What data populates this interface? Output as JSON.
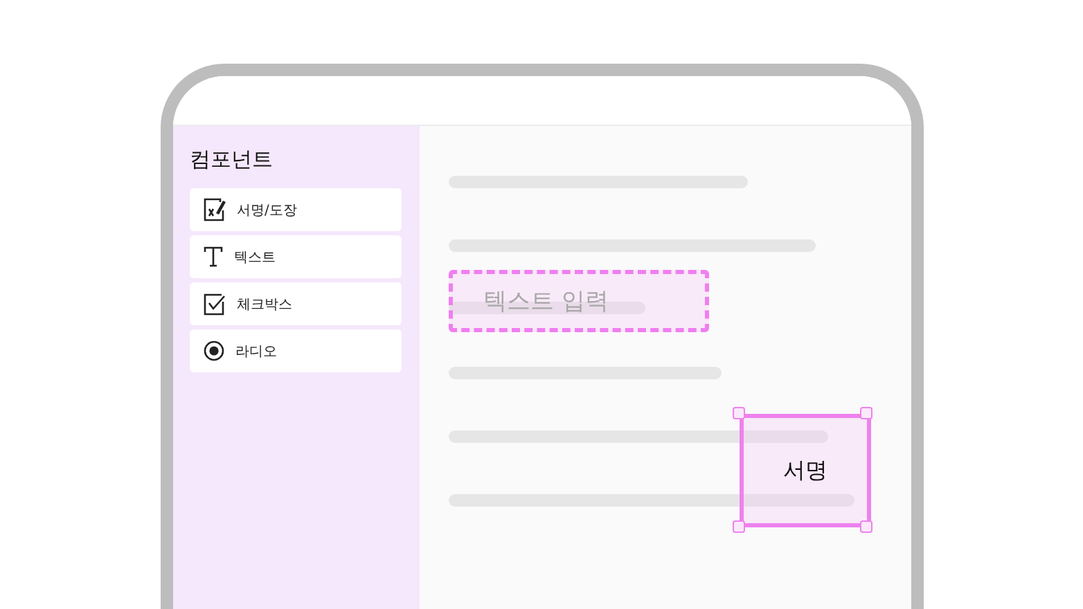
{
  "sidebar": {
    "title": "컴포넌트",
    "items": [
      {
        "kind": "signature",
        "label": "서명/도장"
      },
      {
        "kind": "text",
        "label": "텍스트"
      },
      {
        "kind": "checkbox",
        "label": "체크박스"
      },
      {
        "kind": "radio",
        "label": "라디오"
      }
    ]
  },
  "document": {
    "text_field": {
      "placeholder": "텍스트 입력"
    },
    "signature_field": {
      "label": "서명"
    }
  }
}
